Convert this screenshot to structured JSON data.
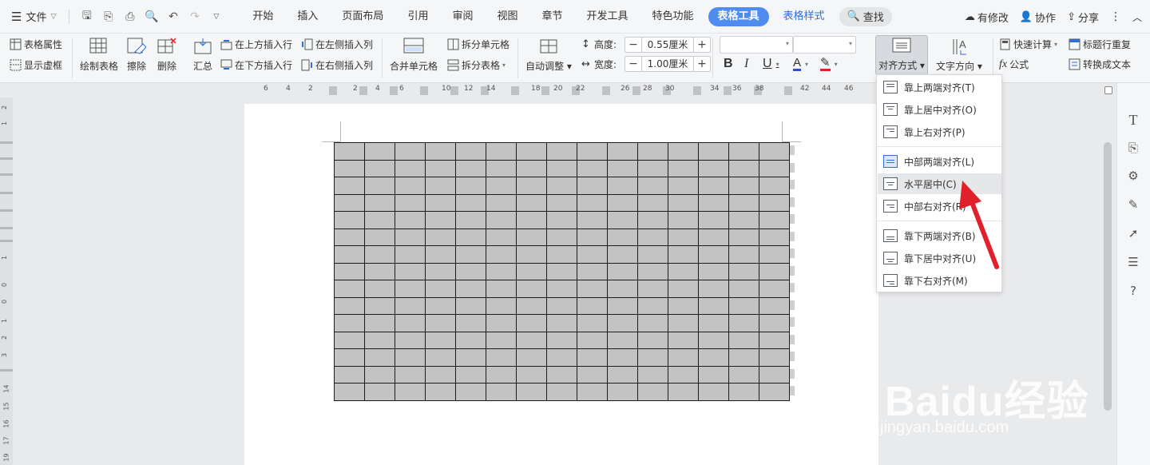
{
  "menubar": {
    "file_label": "文件",
    "tabs": [
      {
        "label": "开始"
      },
      {
        "label": "插入"
      },
      {
        "label": "页面布局"
      },
      {
        "label": "引用"
      },
      {
        "label": "审阅"
      },
      {
        "label": "视图"
      },
      {
        "label": "章节"
      },
      {
        "label": "开发工具"
      },
      {
        "label": "特色功能"
      },
      {
        "label": "表格工具"
      },
      {
        "label": "表格样式"
      }
    ],
    "search_label": "查找",
    "right": {
      "modified": "有修改",
      "collaborate": "协作",
      "share": "分享"
    }
  },
  "ribbon": {
    "table_props": "表格属性",
    "show_gridlines": "显示虚框",
    "draw_table": "绘制表格",
    "erase": "擦除",
    "delete": "删除",
    "summary": "汇总",
    "insert_row_above": "在上方插入行",
    "insert_row_below": "在下方插入行",
    "insert_col_left": "在左侧插入列",
    "insert_col_right": "在右侧插入列",
    "merge_cells": "合并单元格",
    "split_cells": "拆分单元格",
    "split_table": "拆分表格",
    "auto_fit": "自动调整",
    "height_label": "高度:",
    "height_value": "0.55厘米",
    "width_label": "宽度:",
    "width_value": "1.00厘米",
    "bold": "B",
    "italic": "I",
    "underline": "U",
    "font_color_glyph": "A",
    "alignment": "对齐方式",
    "text_direction": "文字方向",
    "quick_calc": "快速计算",
    "repeat_header": "标题行重复",
    "formula_prefix": "fx",
    "formula": "公式",
    "to_text": "转换成文本"
  },
  "ruler": {
    "ticks": [
      "6",
      "4",
      "2",
      "2",
      "4",
      "6",
      "10",
      "12",
      "14",
      "18",
      "20",
      "22",
      "26",
      "28",
      "30",
      "34",
      "36",
      "38",
      "42",
      "44",
      "46"
    ]
  },
  "vruler": {
    "ticks": [
      "2",
      "1",
      "1",
      "0",
      "1",
      "2",
      "3",
      "14",
      "15",
      "16",
      "17",
      "18",
      "19"
    ]
  },
  "align_menu": {
    "items": [
      {
        "label": "靠上两端对齐(T)"
      },
      {
        "label": "靠上居中对齐(O)"
      },
      {
        "label": "靠上右对齐(P)"
      },
      {
        "label": "中部两端对齐(L)"
      },
      {
        "label": "水平居中(C)"
      },
      {
        "label": "中部右对齐(R)"
      },
      {
        "label": "靠下两端对齐(B)"
      },
      {
        "label": "靠下居中对齐(U)"
      },
      {
        "label": "靠下右对齐(M)"
      }
    ]
  },
  "table": {
    "rows": 15,
    "cols": 15
  },
  "watermark": {
    "brand": "Baidu经验",
    "url": "jingyan.baidu.com"
  },
  "colors": {
    "accent": "#4e8cf0",
    "arrow": "#e0212b",
    "cell": "#c3c3c3"
  }
}
